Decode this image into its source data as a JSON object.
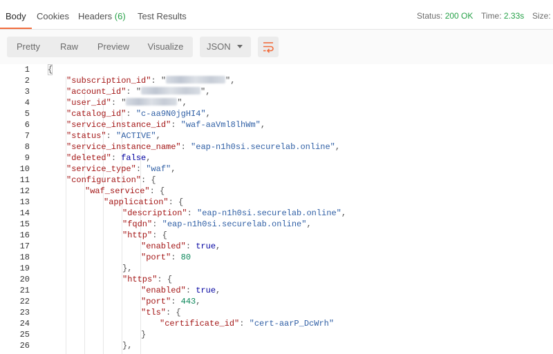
{
  "tabs": [
    {
      "label": "Body"
    },
    {
      "label": "Cookies"
    },
    {
      "label": "Headers",
      "count": "(6)"
    },
    {
      "label": "Test Results"
    }
  ],
  "status": {
    "label": "Status:",
    "value": "200 OK"
  },
  "time": {
    "label": "Time:",
    "value": "2.33s"
  },
  "size": {
    "label": "Size:"
  },
  "toolbar": {
    "pretty": "Pretty",
    "raw": "Raw",
    "preview": "Preview",
    "visualize": "Visualize",
    "format": "JSON"
  },
  "colors": {
    "accent": "#f26b3a",
    "success": "#26a148"
  },
  "code": {
    "line_numbers": [
      "1",
      "2",
      "3",
      "4",
      "5",
      "6",
      "7",
      "8",
      "9",
      "10",
      "11",
      "12",
      "13",
      "14",
      "15",
      "16",
      "17",
      "18",
      "19",
      "20",
      "21",
      "22",
      "23",
      "24",
      "25",
      "26"
    ],
    "lines": [
      {
        "indent": 0,
        "parts": [
          {
            "t": "p",
            "v": "{"
          }
        ]
      },
      {
        "indent": 1,
        "parts": [
          {
            "t": "key",
            "v": "\"subscription_id\""
          },
          {
            "t": "p",
            "v": ": \""
          },
          {
            "t": "blur",
            "w": 86
          },
          {
            "t": "p",
            "v": "\","
          }
        ]
      },
      {
        "indent": 1,
        "parts": [
          {
            "t": "key",
            "v": "\"account_id\""
          },
          {
            "t": "p",
            "v": ": \""
          },
          {
            "t": "blur",
            "w": 86
          },
          {
            "t": "p",
            "v": "\","
          }
        ]
      },
      {
        "indent": 1,
        "parts": [
          {
            "t": "key",
            "v": "\"user_id\""
          },
          {
            "t": "p",
            "v": ": \""
          },
          {
            "t": "blur",
            "w": 74
          },
          {
            "t": "p",
            "v": "\","
          }
        ]
      },
      {
        "indent": 1,
        "parts": [
          {
            "t": "key",
            "v": "\"catalog_id\""
          },
          {
            "t": "p",
            "v": ": "
          },
          {
            "t": "str",
            "v": "\"c-aa9N0jgHI4\""
          },
          {
            "t": "p",
            "v": ","
          }
        ]
      },
      {
        "indent": 1,
        "parts": [
          {
            "t": "key",
            "v": "\"service_instance_id\""
          },
          {
            "t": "p",
            "v": ": "
          },
          {
            "t": "str",
            "v": "\"waf-aaVml8lhWm\""
          },
          {
            "t": "p",
            "v": ","
          }
        ]
      },
      {
        "indent": 1,
        "parts": [
          {
            "t": "key",
            "v": "\"status\""
          },
          {
            "t": "p",
            "v": ": "
          },
          {
            "t": "str",
            "v": "\"ACTIVE\""
          },
          {
            "t": "p",
            "v": ","
          }
        ]
      },
      {
        "indent": 1,
        "parts": [
          {
            "t": "key",
            "v": "\"service_instance_name\""
          },
          {
            "t": "p",
            "v": ": "
          },
          {
            "t": "str",
            "v": "\"eap-n1h0si.securelab.online\""
          },
          {
            "t": "p",
            "v": ","
          }
        ]
      },
      {
        "indent": 1,
        "parts": [
          {
            "t": "key",
            "v": "\"deleted\""
          },
          {
            "t": "p",
            "v": ": "
          },
          {
            "t": "kw",
            "v": "false"
          },
          {
            "t": "p",
            "v": ","
          }
        ]
      },
      {
        "indent": 1,
        "parts": [
          {
            "t": "key",
            "v": "\"service_type\""
          },
          {
            "t": "p",
            "v": ": "
          },
          {
            "t": "str",
            "v": "\"waf\""
          },
          {
            "t": "p",
            "v": ","
          }
        ]
      },
      {
        "indent": 1,
        "parts": [
          {
            "t": "key",
            "v": "\"configuration\""
          },
          {
            "t": "p",
            "v": ": {"
          }
        ]
      },
      {
        "indent": 2,
        "parts": [
          {
            "t": "key",
            "v": "\"waf_service\""
          },
          {
            "t": "p",
            "v": ": {"
          }
        ]
      },
      {
        "indent": 3,
        "parts": [
          {
            "t": "key",
            "v": "\"application\""
          },
          {
            "t": "p",
            "v": ": {"
          }
        ]
      },
      {
        "indent": 4,
        "parts": [
          {
            "t": "key",
            "v": "\"description\""
          },
          {
            "t": "p",
            "v": ": "
          },
          {
            "t": "str",
            "v": "\"eap-n1h0si.securelab.online\""
          },
          {
            "t": "p",
            "v": ","
          }
        ]
      },
      {
        "indent": 4,
        "parts": [
          {
            "t": "key",
            "v": "\"fqdn\""
          },
          {
            "t": "p",
            "v": ": "
          },
          {
            "t": "str",
            "v": "\"eap-n1h0si.securelab.online\""
          },
          {
            "t": "p",
            "v": ","
          }
        ]
      },
      {
        "indent": 4,
        "parts": [
          {
            "t": "key",
            "v": "\"http\""
          },
          {
            "t": "p",
            "v": ": {"
          }
        ]
      },
      {
        "indent": 5,
        "parts": [
          {
            "t": "key",
            "v": "\"enabled\""
          },
          {
            "t": "p",
            "v": ": "
          },
          {
            "t": "kw",
            "v": "true"
          },
          {
            "t": "p",
            "v": ","
          }
        ]
      },
      {
        "indent": 5,
        "parts": [
          {
            "t": "key",
            "v": "\"port\""
          },
          {
            "t": "p",
            "v": ": "
          },
          {
            "t": "num",
            "v": "80"
          }
        ]
      },
      {
        "indent": 4,
        "parts": [
          {
            "t": "p",
            "v": "},"
          }
        ]
      },
      {
        "indent": 4,
        "parts": [
          {
            "t": "key",
            "v": "\"https\""
          },
          {
            "t": "p",
            "v": ": {"
          }
        ]
      },
      {
        "indent": 5,
        "parts": [
          {
            "t": "key",
            "v": "\"enabled\""
          },
          {
            "t": "p",
            "v": ": "
          },
          {
            "t": "kw",
            "v": "true"
          },
          {
            "t": "p",
            "v": ","
          }
        ]
      },
      {
        "indent": 5,
        "parts": [
          {
            "t": "key",
            "v": "\"port\""
          },
          {
            "t": "p",
            "v": ": "
          },
          {
            "t": "num",
            "v": "443"
          },
          {
            "t": "p",
            "v": ","
          }
        ]
      },
      {
        "indent": 5,
        "parts": [
          {
            "t": "key",
            "v": "\"tls\""
          },
          {
            "t": "p",
            "v": ": {"
          }
        ]
      },
      {
        "indent": 6,
        "parts": [
          {
            "t": "key",
            "v": "\"certificate_id\""
          },
          {
            "t": "p",
            "v": ": "
          },
          {
            "t": "str",
            "v": "\"cert-aarP_DcWrh\""
          }
        ]
      },
      {
        "indent": 5,
        "parts": [
          {
            "t": "p",
            "v": "}"
          }
        ]
      },
      {
        "indent": 4,
        "parts": [
          {
            "t": "p",
            "v": "},"
          }
        ]
      }
    ]
  }
}
